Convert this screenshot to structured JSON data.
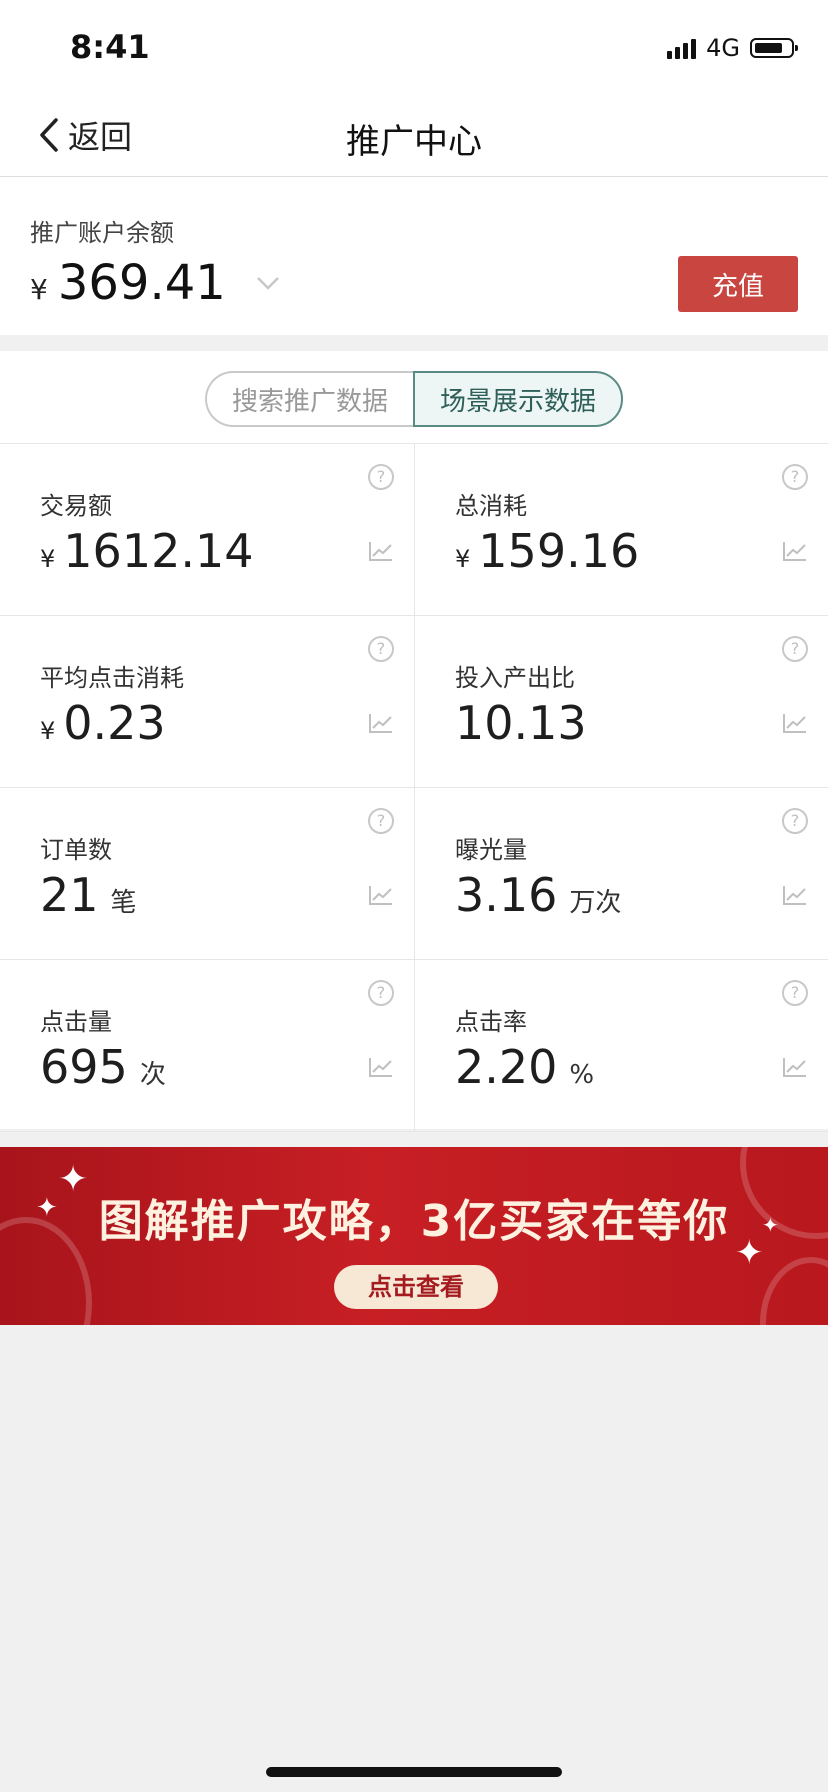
{
  "status_bar": {
    "time": "8:41",
    "network": "4G"
  },
  "nav": {
    "back_label": "返回",
    "title": "推广中心"
  },
  "balance": {
    "label": "推广账户余额",
    "currency": "¥",
    "amount": "369.41",
    "recharge_label": "充值"
  },
  "tabs": [
    {
      "label": "搜索推广数据",
      "active": false
    },
    {
      "label": "场景展示数据",
      "active": true
    }
  ],
  "metrics": [
    {
      "label": "交易额",
      "currency": "¥",
      "value": "1612.14",
      "unit": ""
    },
    {
      "label": "总消耗",
      "currency": "¥",
      "value": "159.16",
      "unit": ""
    },
    {
      "label": "平均点击消耗",
      "currency": "¥",
      "value": "0.23",
      "unit": ""
    },
    {
      "label": "投入产出比",
      "currency": "",
      "value": "10.13",
      "unit": ""
    },
    {
      "label": "订单数",
      "currency": "",
      "value": "21",
      "unit": "笔"
    },
    {
      "label": "曝光量",
      "currency": "",
      "value": "3.16",
      "unit": "万次"
    },
    {
      "label": "点击量",
      "currency": "",
      "value": "695",
      "unit": "次"
    },
    {
      "label": "点击率",
      "currency": "",
      "value": "2.20",
      "unit": "%"
    }
  ],
  "banner": {
    "headline": "图解推广攻略，3亿买家在等你",
    "cta": "点击查看"
  },
  "colors": {
    "accent_red": "#c9453f",
    "tab_active": "#5a8a84",
    "banner_red": "#c71f24"
  },
  "icons": {
    "help": "question-circle-icon",
    "trend": "line-chart-icon",
    "back": "chevron-left-icon",
    "dropdown": "chevron-down-icon"
  }
}
